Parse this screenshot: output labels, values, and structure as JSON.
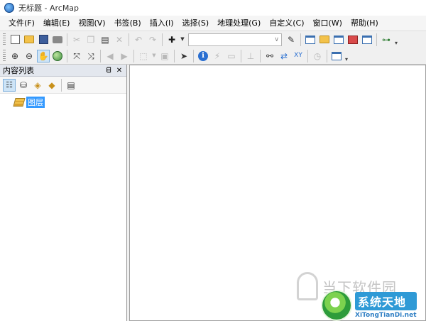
{
  "window": {
    "title": "无标题 - ArcMap"
  },
  "menu": {
    "items": [
      "文件(F)",
      "编辑(E)",
      "视图(V)",
      "书签(B)",
      "插入(I)",
      "选择(S)",
      "地理处理(G)",
      "自定义(C)",
      "窗口(W)",
      "帮助(H)"
    ]
  },
  "toc": {
    "title": "内容列表",
    "pin_glyph": "ᗺ",
    "close_glyph": "✕",
    "root_layer": "图层"
  },
  "watermarks": {
    "site1": "当下软件园",
    "site2_name": "系统天地",
    "site2_url": "XiTongTianDi.net"
  },
  "colors": {
    "selection": "#3399ff",
    "panel_header": "#e3e7ee"
  }
}
